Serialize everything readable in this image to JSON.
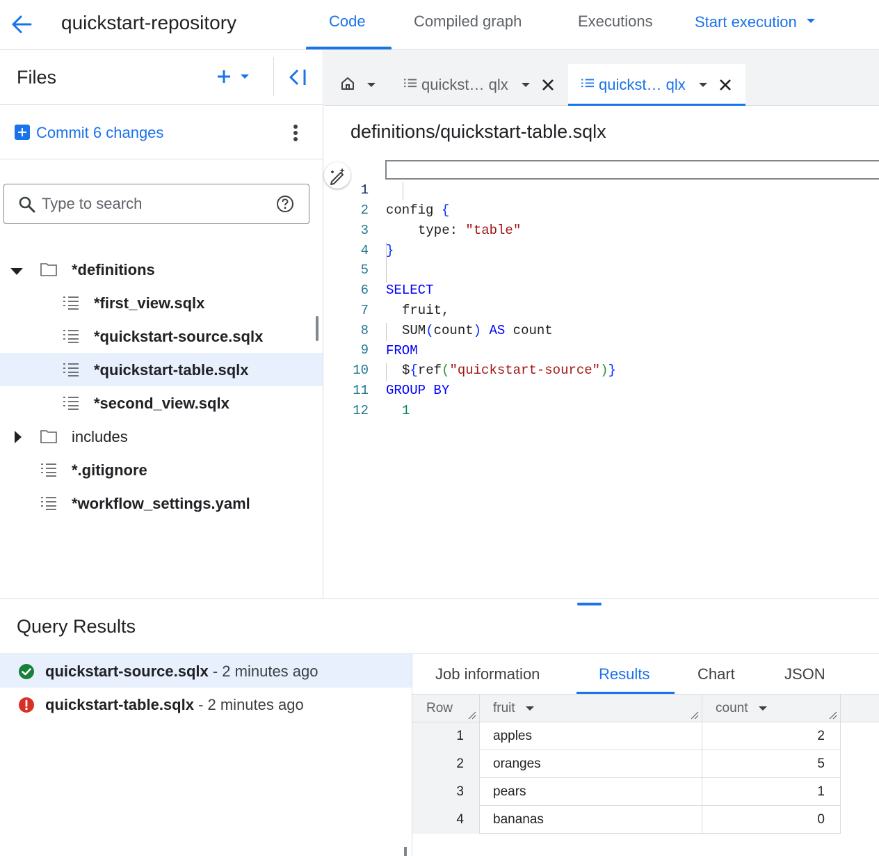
{
  "header": {
    "repo_title": "quickstart-repository",
    "tabs": [
      {
        "label": "Code",
        "active": true
      },
      {
        "label": "Compiled graph"
      },
      {
        "label": "Executions"
      }
    ],
    "start_execution_label": "Start execution"
  },
  "sidebar": {
    "title": "Files",
    "commit_label": "Commit 6 changes",
    "search_placeholder": "Type to search",
    "tree": [
      {
        "label": "*definitions",
        "type": "folder",
        "expanded": true
      },
      {
        "label": "*first_view.sqlx",
        "type": "file"
      },
      {
        "label": "*quickstart-source.sqlx",
        "type": "file"
      },
      {
        "label": "*quickstart-table.sqlx",
        "type": "file",
        "selected": true
      },
      {
        "label": "*second_view.sqlx",
        "type": "file"
      },
      {
        "label": "includes",
        "type": "folder",
        "expanded": false
      },
      {
        "label": "*.gitignore",
        "type": "file"
      },
      {
        "label": "*workflow_settings.yaml",
        "type": "file"
      }
    ]
  },
  "editor": {
    "tabs": [
      {
        "label": "home",
        "icon": "home-icon"
      },
      {
        "label": "quickst… qlx",
        "icon": "file-lines-icon"
      },
      {
        "label": "quickst… qlx",
        "icon": "file-lines-icon",
        "active": true
      }
    ],
    "file_path": "definitions/quickstart-table.sqlx",
    "line_numbers": [
      "1",
      "2",
      "3",
      "4",
      "5",
      "6",
      "7",
      "8",
      "9",
      "10",
      "11",
      "12"
    ],
    "code": {
      "l1_kw": "config",
      "l1_brace": "{",
      "l2_key": "type: ",
      "l2_str": "\"table\"",
      "l3_brace": "}",
      "l5": "SELECT",
      "l6": "fruit,",
      "l7_fn": "SUM",
      "l7_open": "(",
      "l7_arg": "count",
      "l7_close": ")",
      "l7_as": "AS",
      "l7_alias": "count",
      "l8": "FROM",
      "l9_dollar": "$",
      "l9_open": "{",
      "l9_ref": "ref",
      "l9_popen": "(",
      "l9_str": "\"quickstart-source\"",
      "l9_pclose": ")",
      "l9_close": "}",
      "l10": "GROUP BY",
      "l11": "1"
    }
  },
  "results": {
    "title": "Query Results",
    "jobs": [
      {
        "file": "quickstart-source.sqlx",
        "time": " - 2 minutes ago",
        "status": "success",
        "selected": true
      },
      {
        "file": "quickstart-table.sqlx",
        "time": " - 2 minutes ago",
        "status": "error"
      }
    ],
    "tabs": [
      {
        "label": "Job information"
      },
      {
        "label": "Results",
        "active": true
      },
      {
        "label": "Chart"
      },
      {
        "label": "JSON"
      }
    ],
    "table": {
      "columns": [
        "Row",
        "fruit",
        "count"
      ],
      "rows": [
        [
          "1",
          "apples",
          "2"
        ],
        [
          "2",
          "oranges",
          "5"
        ],
        [
          "3",
          "pears",
          "1"
        ],
        [
          "4",
          "bananas",
          "0"
        ]
      ]
    }
  },
  "colors": {
    "accent": "#1a73e8",
    "selected_bg": "#e8f0fe",
    "success": "#188038",
    "error": "#d93025"
  }
}
